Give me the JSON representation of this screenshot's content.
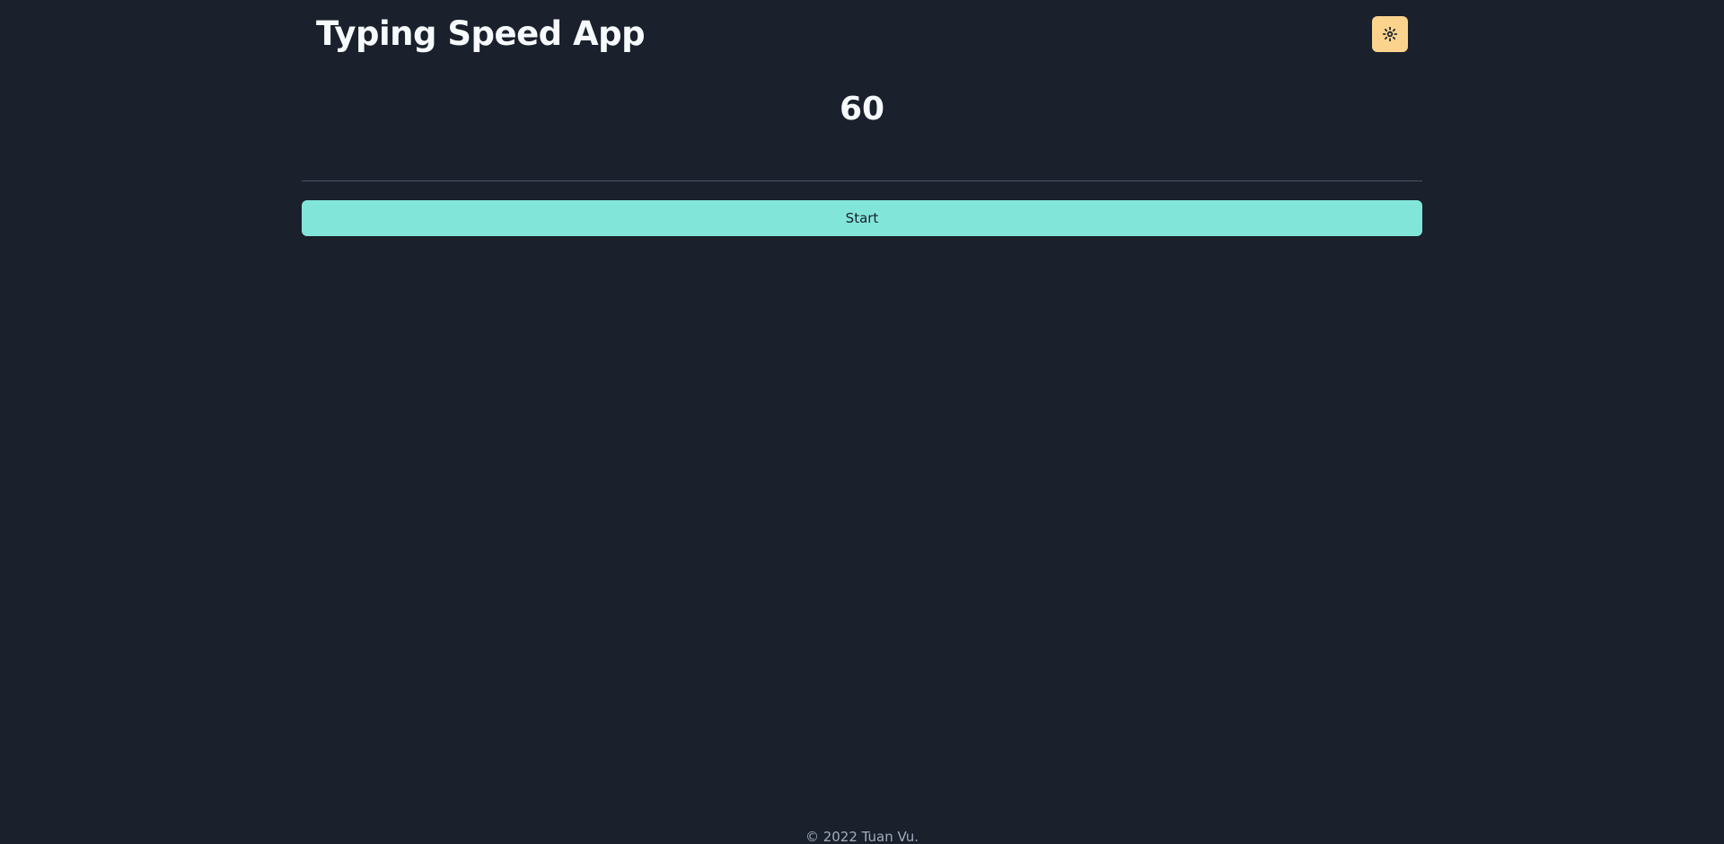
{
  "header": {
    "title": "Typing Speed App",
    "theme_toggle_icon": "sun-icon"
  },
  "main": {
    "timer_value": "60",
    "start_label": "Start"
  },
  "footer": {
    "copyright": "© 2022 Tuan Vu."
  },
  "colors": {
    "background": "#1a202c",
    "accent": "#81e6d9",
    "toggle": "#fbd38d"
  }
}
